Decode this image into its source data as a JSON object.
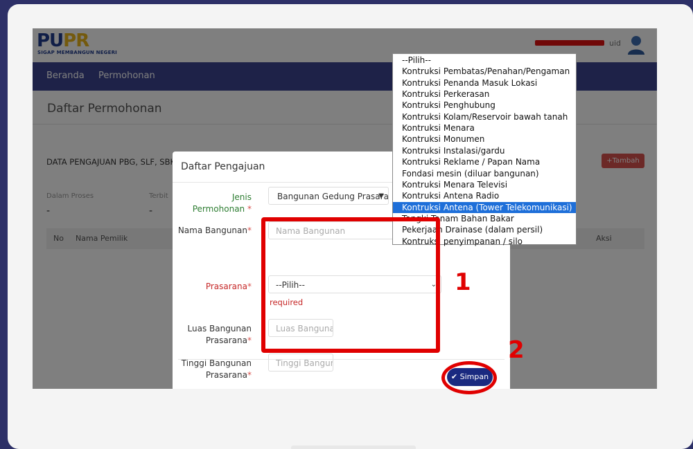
{
  "header": {
    "logo_text_a": "PU",
    "logo_text_b": "PR",
    "logo_tagline": "SIGAP MEMBANGUN NEGERI",
    "user_name": "uid"
  },
  "nav": {
    "items": [
      "Beranda",
      "Permohonan"
    ]
  },
  "page": {
    "title": "Daftar Permohonan",
    "card_title": "DATA PENGAJUAN PBG, SLF, SBKI",
    "tambah_label": "+Tambah",
    "stats": [
      {
        "label": "Dalam Proses",
        "value": "-"
      },
      {
        "label": "Terbit",
        "value": "-"
      }
    ],
    "columns": [
      "No",
      "Nama Pemilik",
      "Aksi"
    ]
  },
  "modal": {
    "title": "Daftar Pengajuan",
    "jenis_label": "Jenis",
    "jenis_label2": "Permohonan",
    "jenis_value": "Bangunan Gedung Prasara",
    "nama_label": "Nama Bangunan",
    "nama_placeholder": "Nama Bangunan",
    "prasarana_label": "Prasarana",
    "prasarana_value": "--Pilih--",
    "required_msg": "required",
    "luas_label": "Luas Bangunan",
    "luas_label2": "Prasarana",
    "luas_placeholder": "Luas Bangunai",
    "tinggi_label": "Tinggi Bangunan",
    "tinggi_label2": "Prasarana",
    "tinggi_placeholder": "Tinggi Bangun.",
    "req_mark": "*",
    "simpan_label": "✔ Simpan"
  },
  "dropdown": {
    "options": [
      "--Pilih--",
      "Kontruksi Pembatas/Penahan/Pengaman",
      "Kontruksi Penanda Masuk Lokasi",
      "Kontruksi Perkerasan",
      "Kontruksi Penghubung",
      "Kontruksi Kolam/Reservoir bawah tanah",
      "Kontruksi Menara",
      "Kontruksi Monumen",
      "Kontruksi Instalasi/gardu",
      "Kontruksi Reklame / Papan Nama",
      "Fondasi mesin (diluar bangunan)",
      "Kontruksi Menara Televisi",
      "Kontruksi Antena Radio",
      "Kontruksi Antena (Tower Telekomunikasi)",
      "Tangki Tanam Bahan Bakar",
      "Pekerjaan Drainase (dalam persil)",
      "Kontruksi penyimpanan / silo"
    ],
    "selected_index": 13
  },
  "annotations": {
    "step1": "1",
    "step2": "2"
  },
  "colors": {
    "navbar": "#3c4591",
    "highlight": "#1e6fd9",
    "annotation": "#e00000",
    "button": "#1a2a80"
  }
}
